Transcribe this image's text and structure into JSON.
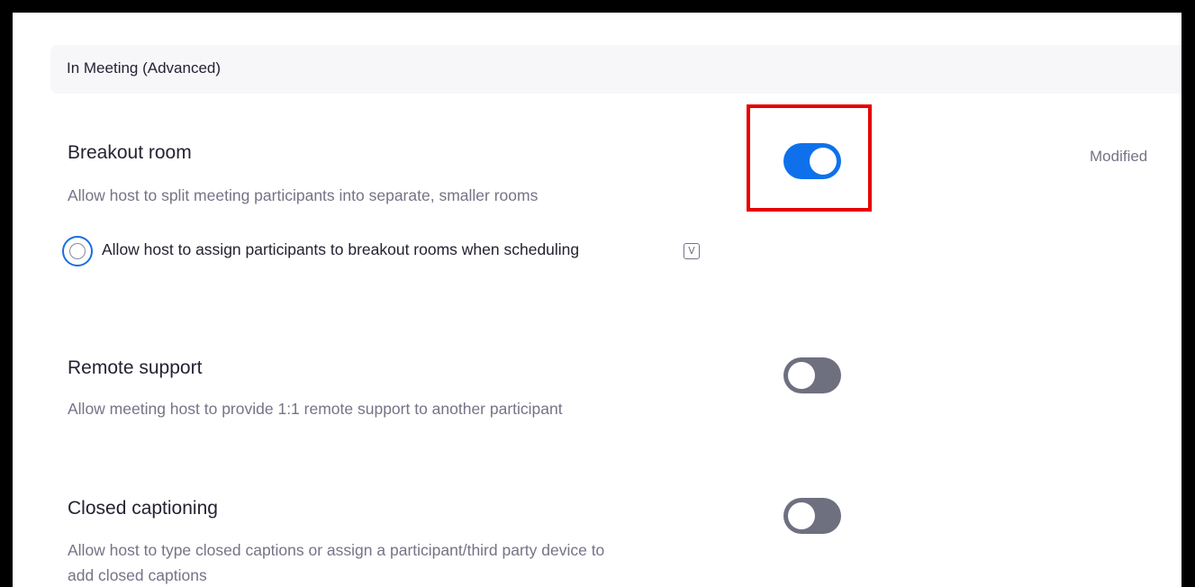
{
  "section": {
    "title": "In Meeting (Advanced)"
  },
  "settings": [
    {
      "title": "Breakout room",
      "description": "Allow host to split meeting participants into separate, smaller rooms",
      "enabled": true,
      "status": "Modified",
      "option": {
        "label": "Allow host to assign participants to breakout rooms when scheduling",
        "checked": false,
        "badge_icon": "v-badge-icon",
        "badge_text": "V"
      }
    },
    {
      "title": "Remote support",
      "description": "Allow meeting host to provide 1:1 remote support to another participant",
      "enabled": false
    },
    {
      "title": "Closed captioning",
      "description_line1": "Allow host to type closed captions or assign a participant/third party device to",
      "description_line2": "add closed captions",
      "enabled": false
    }
  ],
  "colors": {
    "toggle_on": "#0e71eb",
    "toggle_off": "#6e7080",
    "highlight": "#e60000"
  }
}
